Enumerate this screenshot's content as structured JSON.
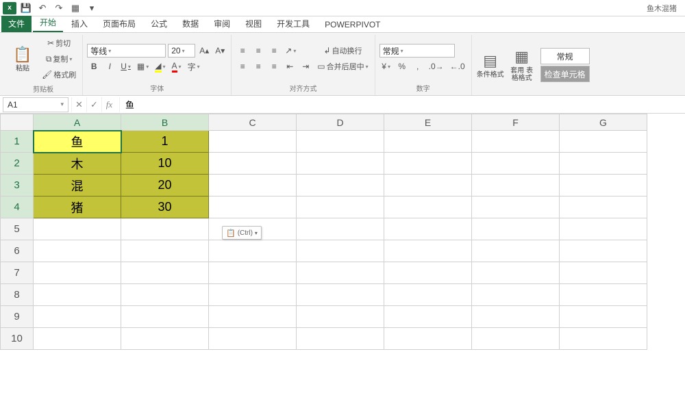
{
  "qat": {
    "title_right": "鱼木混猪",
    "save": "save",
    "undo": "undo",
    "redo": "redo",
    "preview": "preview"
  },
  "tabs": {
    "file": "文件",
    "items": [
      "开始",
      "插入",
      "页面布局",
      "公式",
      "数据",
      "审阅",
      "视图",
      "开发工具",
      "POWERPIVOT"
    ],
    "active_index": 0
  },
  "ribbon": {
    "clipboard": {
      "paste": "粘贴",
      "cut": "剪切",
      "copy": "复制",
      "format_painter": "格式刷",
      "label": "剪贴板"
    },
    "font": {
      "name": "等线",
      "size": "20",
      "label": "字体",
      "bold": "B",
      "italic": "I",
      "underline": "U"
    },
    "align": {
      "wrap": "自动换行",
      "merge": "合并后居中",
      "label": "对齐方式"
    },
    "number": {
      "format": "常规",
      "label": "数字",
      "percent": "%",
      "comma": ",",
      "inc": ".0",
      "dec": ".00"
    },
    "styles": {
      "cond": "条件格式",
      "table": "套用\n表格格式",
      "normal": "常规",
      "check": "检查单元格"
    }
  },
  "fbar": {
    "name": "A1",
    "value": "鱼"
  },
  "grid": {
    "cols": [
      "A",
      "B",
      "C",
      "D",
      "E",
      "F",
      "G"
    ],
    "rows": [
      "1",
      "2",
      "3",
      "4",
      "5",
      "6",
      "7",
      "8",
      "9",
      "10"
    ],
    "data": {
      "A1": "鱼",
      "B1": "1",
      "A2": "木",
      "B2": "10",
      "A3": "混",
      "B3": "20",
      "A4": "猪",
      "B4": "30"
    },
    "paste_tag": "(Ctrl)"
  }
}
